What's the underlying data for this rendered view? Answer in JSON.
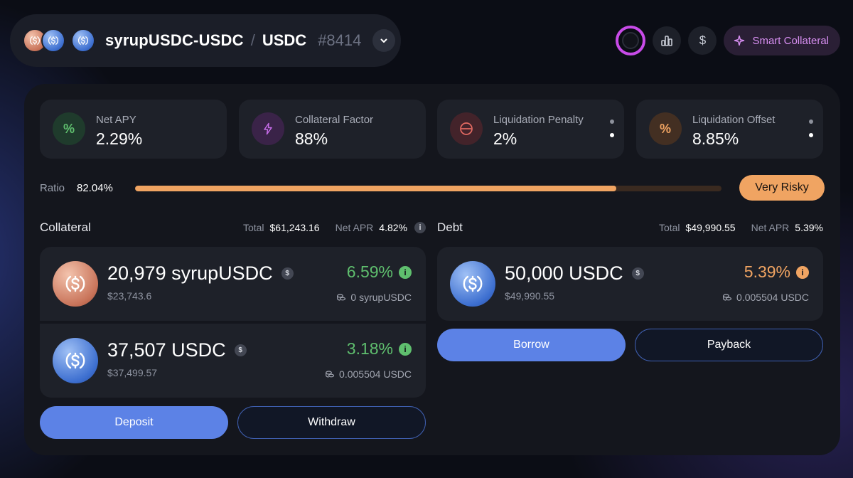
{
  "header": {
    "pair_name": "syrupUSDC-USDC",
    "separator": "/",
    "quote": "USDC",
    "pair_id": "#8414",
    "smart_collateral_label": "Smart Collateral",
    "icons": [
      "dropdown-chevron-icon",
      "bar-chart-icon",
      "dollar-icon",
      "sparkle-icon"
    ]
  },
  "stats": [
    {
      "label": "Net APY",
      "value": "2.29%",
      "icon": "percent-icon",
      "color": "#5fbf6e"
    },
    {
      "label": "Collateral Factor",
      "value": "88%",
      "icon": "bolt-icon",
      "color": "#c46be6"
    },
    {
      "label": "Liquidation Penalty",
      "value": "2%",
      "icon": "minus-circle-icon",
      "color": "#e56b63"
    },
    {
      "label": "Liquidation Offset",
      "value": "8.85%",
      "icon": "percent-icon",
      "color": "#f0a462"
    }
  ],
  "ratio": {
    "label": "Ratio",
    "value": "82.04%",
    "fill": 0.82,
    "risk": "Very Risky",
    "color": "#f0a462"
  },
  "collateral": {
    "title": "Collateral",
    "total_label": "Total",
    "total": "$61,243.16",
    "net_apr_label": "Net APR",
    "net_apr": "4.82%",
    "assets": [
      {
        "amount": "20,979 syrupUSDC",
        "usd": "$23,743.6",
        "rate": "6.59%",
        "sub": "0 syrupUSDC",
        "coin": "syrupUSDC"
      },
      {
        "amount": "37,507 USDC",
        "usd": "$37,499.57",
        "rate": "3.18%",
        "sub": "0.005504 USDC",
        "coin": "USDC"
      }
    ],
    "deposit_label": "Deposit",
    "withdraw_label": "Withdraw"
  },
  "debt": {
    "title": "Debt",
    "total_label": "Total",
    "total": "$49,990.55",
    "net_apr_label": "Net APR",
    "net_apr": "5.39%",
    "assets": [
      {
        "amount": "50,000 USDC",
        "usd": "$49,990.55",
        "rate": "5.39%",
        "sub": "0.005504 USDC",
        "coin": "USDC"
      }
    ],
    "borrow_label": "Borrow",
    "payback_label": "Payback"
  },
  "colors": {
    "positive": "#5fbf6e",
    "debt_rate": "#f0a462",
    "accent_blue": "#5c82e6"
  }
}
